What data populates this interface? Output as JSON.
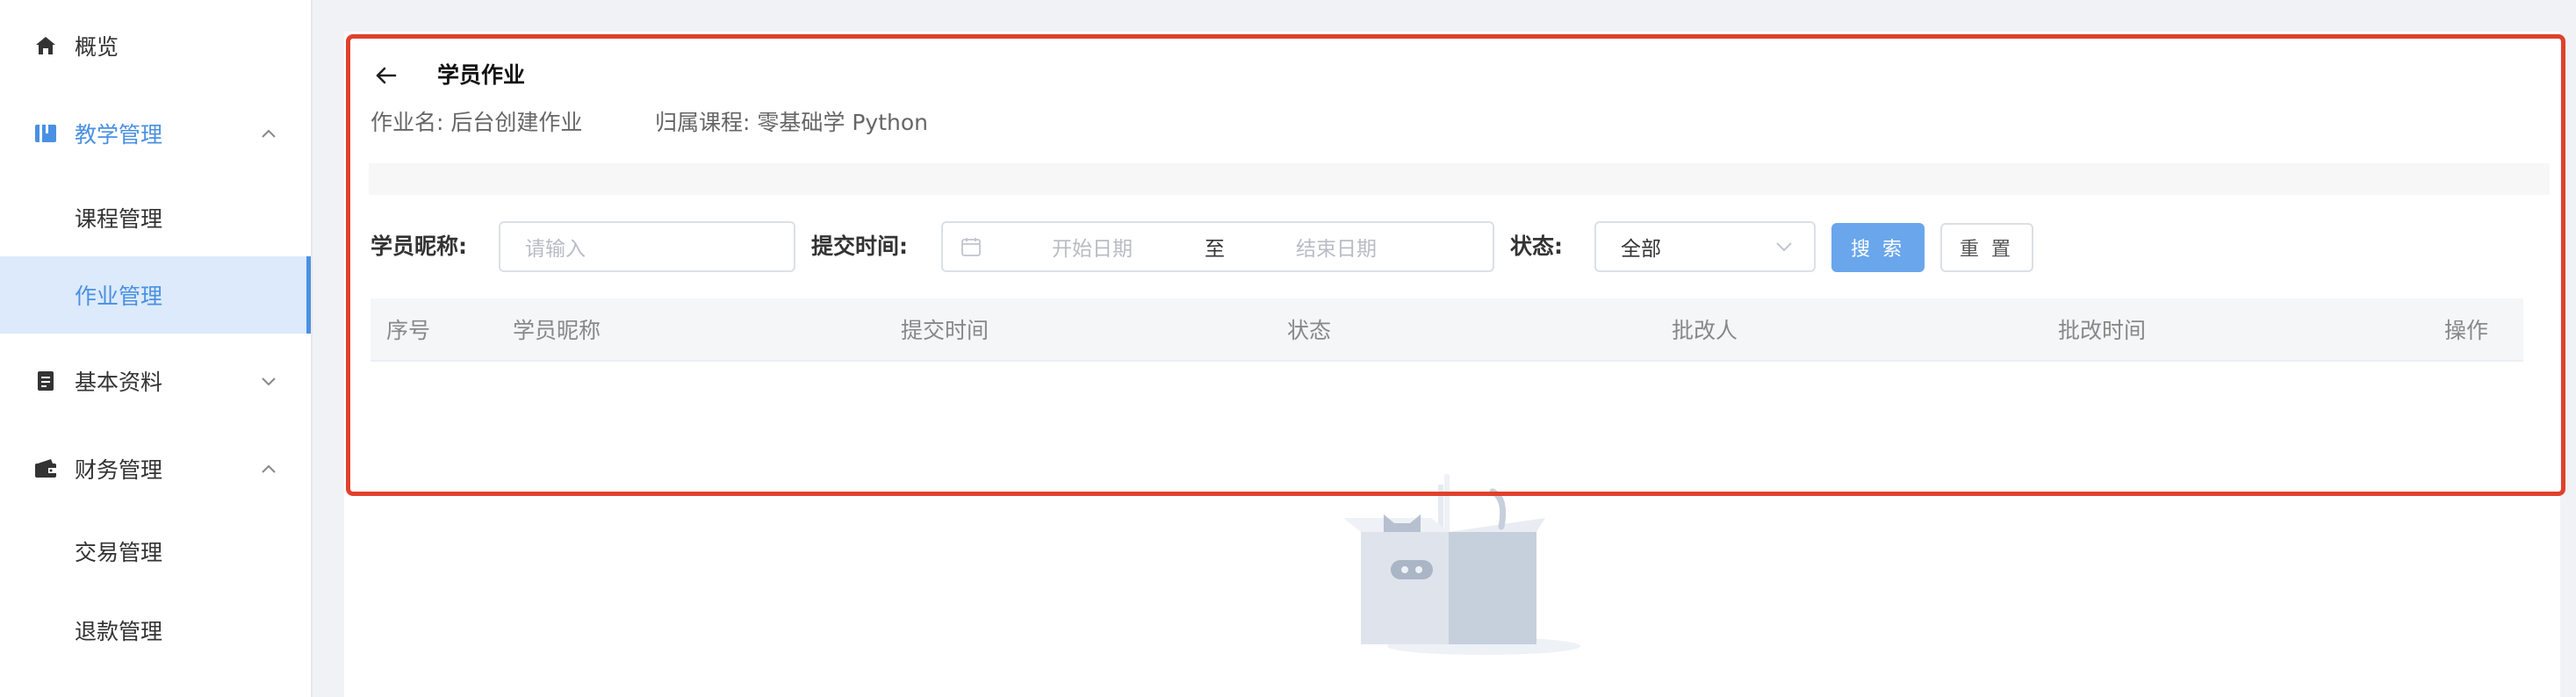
{
  "sidebar": {
    "items": [
      {
        "label": "概览",
        "icon": "home-icon"
      },
      {
        "label": "教学管理",
        "icon": "book-icon",
        "expanded": true,
        "children": [
          {
            "label": "课程管理"
          },
          {
            "label": "作业管理",
            "selected": true
          }
        ]
      },
      {
        "label": "基本资料",
        "icon": "document-icon",
        "expanded": false
      },
      {
        "label": "财务管理",
        "icon": "wallet-icon",
        "expanded": true,
        "children": [
          {
            "label": "交易管理"
          },
          {
            "label": "退款管理"
          }
        ]
      }
    ]
  },
  "header": {
    "back_icon": "arrow-left-icon",
    "title": "学员作业",
    "homework_key": "作业名:",
    "homework_value": "后台创建作业",
    "course_key": "归属课程:",
    "course_value": "零基础学 Python"
  },
  "filters": {
    "nickname_label": "学员昵称:",
    "nickname_placeholder": "请输入",
    "time_label": "提交时间:",
    "start_placeholder": "开始日期",
    "range_separator": "至",
    "end_placeholder": "结束日期",
    "status_label": "状态:",
    "status_value": "全部",
    "search_button": "搜 索",
    "reset_button": "重 置"
  },
  "table": {
    "columns": [
      "序号",
      "学员昵称",
      "提交时间",
      "状态",
      "批改人",
      "批改时间",
      "操作"
    ],
    "rows": []
  },
  "colors": {
    "accent": "#4a90e2",
    "selected_bg": "#dceafc",
    "highlight_border": "#e0412c",
    "primary_button": "#6aa6ec"
  }
}
